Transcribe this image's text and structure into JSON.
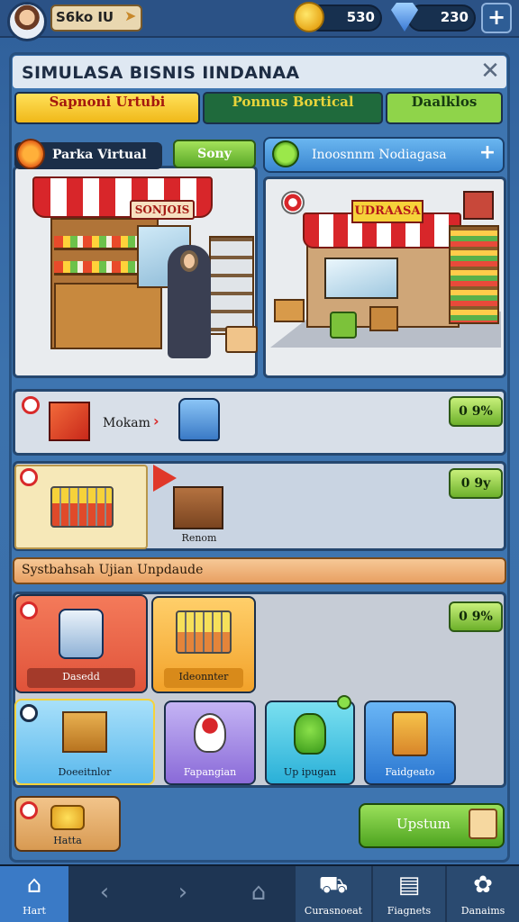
{
  "player": {
    "name": "S6ko IU"
  },
  "currency": {
    "coins": "530",
    "gems": "230",
    "plus": "+"
  },
  "panel": {
    "title": "SIMULASA BISNIS IINDANAA",
    "close": "✕",
    "tabs": [
      {
        "label": "Sapnoni Urtubi"
      },
      {
        "label": "Ponnus Bortical"
      },
      {
        "label": "Daalklos"
      }
    ]
  },
  "stores": {
    "left": {
      "label": "Parka Virtual",
      "button": "Sony",
      "sign": "SONJOIS"
    },
    "right": {
      "label": "Inoosnnm Nodiagasa",
      "plus": "+",
      "sign": "UDRAASA"
    }
  },
  "production": {
    "row1": {
      "label": "Mokam",
      "percent": "0 9%"
    },
    "row2": {
      "crate_label": "Renom",
      "percent": "0 9y"
    }
  },
  "upgrade": {
    "banner": "Systbahsah Ujian Unpdaude",
    "percent": "0 9%",
    "tiles": [
      {
        "label": "Dasedd"
      },
      {
        "label": "Ideonnter"
      },
      {
        "label": "Doeeitnlor"
      },
      {
        "label": "Fapangian"
      },
      {
        "label": "Up ipugan"
      },
      {
        "label": "Faidgeato"
      },
      {
        "label": "Hatta"
      }
    ],
    "button": "Upstum"
  },
  "nav": [
    {
      "label": "Hart"
    },
    {
      "label": ""
    },
    {
      "label": ""
    },
    {
      "label": ""
    },
    {
      "label": "Curasnoeat"
    },
    {
      "label": "Fiagnets"
    },
    {
      "label": "Danaims"
    }
  ],
  "icons": {
    "coin": "coin-icon",
    "gem": "gem-icon",
    "home": "home-icon",
    "back": "arrow-left-icon",
    "forward": "arrow-right-icon",
    "house": "house-outline-icon"
  },
  "colors": {
    "accent_green": "#6cb02a",
    "accent_yellow": "#f0b818",
    "panel_blue": "#3e75b0",
    "badge_red": "#d82a2a"
  }
}
